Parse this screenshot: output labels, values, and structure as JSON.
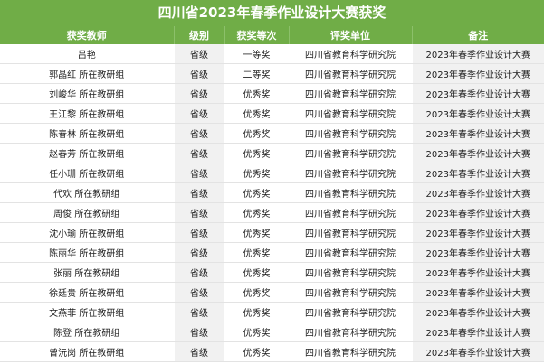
{
  "title": "四川省2023年春季作业设计大赛获奖",
  "colors": {
    "header_green": "#70ad47",
    "header_text": "#ffffff",
    "shaded_column": "#f1f1f1"
  },
  "columns": [
    "获奖教师",
    "级别",
    "获奖等次",
    "评奖单位",
    "备注"
  ],
  "rows": [
    {
      "teacher": "吕艳",
      "level": "省级",
      "award": "一等奖",
      "unit": "四川省教育科学研究院",
      "note": "2023年春季作业设计大赛"
    },
    {
      "teacher": "郭晶红 所在教研组",
      "level": "省级",
      "award": "二等奖",
      "unit": "四川省教育科学研究院",
      "note": "2023年春季作业设计大赛"
    },
    {
      "teacher": "刘峻华 所在教研组",
      "level": "省级",
      "award": "优秀奖",
      "unit": "四川省教育科学研究院",
      "note": "2023年春季作业设计大赛"
    },
    {
      "teacher": "王江黎 所在教研组",
      "level": "省级",
      "award": "优秀奖",
      "unit": "四川省教育科学研究院",
      "note": "2023年春季作业设计大赛"
    },
    {
      "teacher": "陈春林 所在教研组",
      "level": "省级",
      "award": "优秀奖",
      "unit": "四川省教育科学研究院",
      "note": "2023年春季作业设计大赛"
    },
    {
      "teacher": "赵春芳 所在教研组",
      "level": "省级",
      "award": "优秀奖",
      "unit": "四川省教育科学研究院",
      "note": "2023年春季作业设计大赛"
    },
    {
      "teacher": "任小珊 所在教研组",
      "level": "省级",
      "award": "优秀奖",
      "unit": "四川省教育科学研究院",
      "note": "2023年春季作业设计大赛"
    },
    {
      "teacher": "代欢 所在教研组",
      "level": "省级",
      "award": "优秀奖",
      "unit": "四川省教育科学研究院",
      "note": "2023年春季作业设计大赛"
    },
    {
      "teacher": "周俊 所在教研组",
      "level": "省级",
      "award": "优秀奖",
      "unit": "四川省教育科学研究院",
      "note": "2023年春季作业设计大赛"
    },
    {
      "teacher": "沈小瑜 所在教研组",
      "level": "省级",
      "award": "优秀奖",
      "unit": "四川省教育科学研究院",
      "note": "2023年春季作业设计大赛"
    },
    {
      "teacher": "陈丽华 所在教研组",
      "level": "省级",
      "award": "优秀奖",
      "unit": "四川省教育科学研究院",
      "note": "2023年春季作业设计大赛"
    },
    {
      "teacher": "张丽 所在教研组",
      "level": "省级",
      "award": "优秀奖",
      "unit": "四川省教育科学研究院",
      "note": "2023年春季作业设计大赛"
    },
    {
      "teacher": "徐廷贵 所在教研组",
      "level": "省级",
      "award": "优秀奖",
      "unit": "四川省教育科学研究院",
      "note": "2023年春季作业设计大赛"
    },
    {
      "teacher": "文燕菲 所在教研组",
      "level": "省级",
      "award": "优秀奖",
      "unit": "四川省教育科学研究院",
      "note": "2023年春季作业设计大赛"
    },
    {
      "teacher": "陈登 所在教研组",
      "level": "省级",
      "award": "优秀奖",
      "unit": "四川省教育科学研究院",
      "note": "2023年春季作业设计大赛"
    },
    {
      "teacher": "曾沅岗 所在教研组",
      "level": "省级",
      "award": "优秀奖",
      "unit": "四川省教育科学研究院",
      "note": "2023年春季作业设计大赛"
    }
  ]
}
